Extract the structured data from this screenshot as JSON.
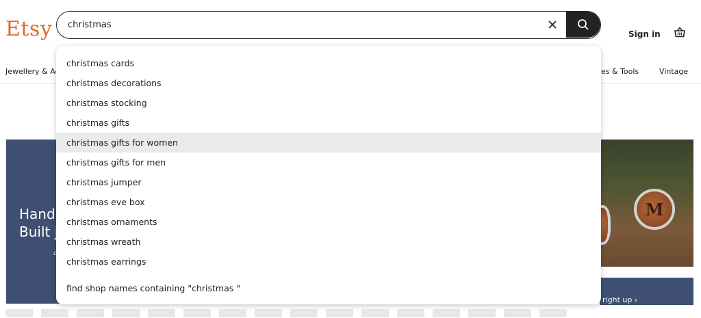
{
  "header": {
    "logo": "Etsy",
    "search_value": "christmas",
    "sign_in": "Sign in"
  },
  "nav": {
    "items": [
      "Jewellery & Ac",
      "es & Tools",
      "Vintage"
    ]
  },
  "hero": {
    "line1": "Hand",
    "line2": "Built j",
    "small": "c",
    "photo_letter": "M",
    "banner_text": "right up  ›"
  },
  "dropdown": {
    "suggestions": [
      "christmas cards",
      "christmas decorations",
      "christmas stocking",
      "christmas gifts",
      "christmas gifts for women",
      "christmas gifts for men",
      "christmas jumper",
      "christmas eve box",
      "christmas ornaments",
      "christmas wreath",
      "christmas earrings"
    ],
    "active_index": 4,
    "shop_names": "find shop names containing \"christmas \""
  },
  "colors": {
    "brand": "#e2692b",
    "search_button": "#222222",
    "highlight": "#eaeaea",
    "hero": "#3e4f72"
  },
  "icons": {
    "clear": "close-icon",
    "search": "search-icon",
    "cart": "basket-icon"
  }
}
